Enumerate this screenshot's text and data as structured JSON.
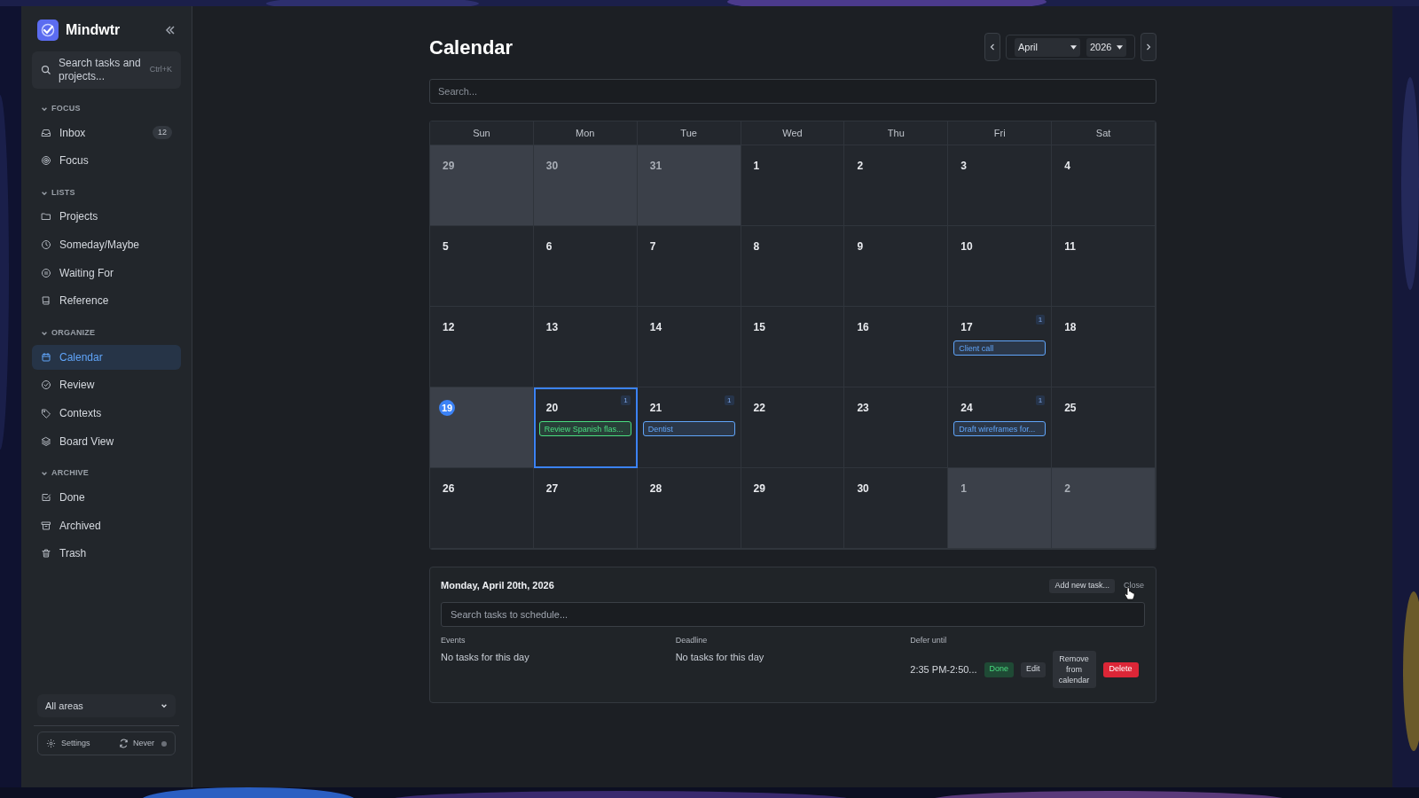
{
  "app": {
    "name": "Mindwtr"
  },
  "search": {
    "placeholder": "Search tasks and projects...",
    "shortcut": "Ctrl+K"
  },
  "sidebar": {
    "sections": [
      {
        "title": "FOCUS",
        "expanded": true,
        "items": [
          {
            "kind": "inbox",
            "label": "Inbox",
            "badge": "12",
            "selected": false
          },
          {
            "kind": "target",
            "label": "Focus",
            "selected": false
          }
        ]
      },
      {
        "title": "LISTS",
        "expanded": true,
        "items": [
          {
            "kind": "folder",
            "label": "Projects",
            "selected": false
          },
          {
            "kind": "clock",
            "label": "Someday/Maybe",
            "selected": false
          },
          {
            "kind": "pause",
            "label": "Waiting For",
            "selected": false
          },
          {
            "kind": "book",
            "label": "Reference",
            "selected": false
          }
        ]
      },
      {
        "title": "ORGANIZE",
        "expanded": true,
        "items": [
          {
            "kind": "calendar",
            "label": "Calendar",
            "selected": true
          },
          {
            "kind": "review",
            "label": "Review",
            "selected": false
          },
          {
            "kind": "tag",
            "label": "Contexts",
            "selected": false
          },
          {
            "kind": "layers",
            "label": "Board View",
            "selected": false
          }
        ]
      },
      {
        "title": "ARCHIVE",
        "expanded": true,
        "items": [
          {
            "kind": "done",
            "label": "Done",
            "selected": false
          },
          {
            "kind": "archive",
            "label": "Archived",
            "selected": false
          },
          {
            "kind": "trash",
            "label": "Trash",
            "selected": false
          }
        ]
      }
    ],
    "area": "All areas",
    "settings": "Settings",
    "sync": "Never"
  },
  "page": {
    "title": "Calendar",
    "month": "April",
    "year": "2026",
    "search_placeholder": "Search..."
  },
  "calendar": {
    "weekdays": [
      "Sun",
      "Mon",
      "Tue",
      "Wed",
      "Thu",
      "Fri",
      "Sat"
    ],
    "weeks": [
      [
        {
          "day": "29",
          "outside": true
        },
        {
          "day": "30",
          "outside": true
        },
        {
          "day": "31",
          "outside": true
        },
        {
          "day": "1",
          "outside": false
        },
        {
          "day": "2",
          "outside": false
        },
        {
          "day": "3",
          "outside": false
        },
        {
          "day": "4",
          "outside": false
        }
      ],
      [
        {
          "day": "5",
          "outside": false
        },
        {
          "day": "6",
          "outside": false
        },
        {
          "day": "7",
          "outside": false
        },
        {
          "day": "8",
          "outside": false
        },
        {
          "day": "9",
          "outside": false
        },
        {
          "day": "10",
          "outside": false
        },
        {
          "day": "11",
          "outside": false
        }
      ],
      [
        {
          "day": "12",
          "outside": false
        },
        {
          "day": "13",
          "outside": false
        },
        {
          "day": "14",
          "outside": false
        },
        {
          "day": "15",
          "outside": false
        },
        {
          "day": "16",
          "outside": false
        },
        {
          "day": "17",
          "outside": false,
          "count": "1",
          "events": [
            {
              "title": "Client call",
              "color": "#60a5fa"
            }
          ]
        },
        {
          "day": "18",
          "outside": false
        }
      ],
      [
        {
          "day": "19",
          "outside": false,
          "today": true
        },
        {
          "day": "20",
          "outside": false,
          "selected": true,
          "count": "1",
          "events": [
            {
              "title": "Review Spanish flas...",
              "color": "#4ade80"
            }
          ]
        },
        {
          "day": "21",
          "outside": false,
          "count": "1",
          "events": [
            {
              "title": "Dentist",
              "color": "#60a5fa"
            }
          ]
        },
        {
          "day": "22",
          "outside": false
        },
        {
          "day": "23",
          "outside": false
        },
        {
          "day": "24",
          "outside": false,
          "count": "1",
          "events": [
            {
              "title": "Draft wireframes for...",
              "color": "#60a5fa"
            }
          ]
        },
        {
          "day": "25",
          "outside": false
        }
      ],
      [
        {
          "day": "26",
          "outside": false
        },
        {
          "day": "27",
          "outside": false
        },
        {
          "day": "28",
          "outside": false
        },
        {
          "day": "29",
          "outside": false
        },
        {
          "day": "30",
          "outside": false
        },
        {
          "day": "1",
          "outside": true
        },
        {
          "day": "2",
          "outside": true
        }
      ]
    ]
  },
  "day_panel": {
    "title": "Monday, April 20th, 2026",
    "add_button": "Add new task...",
    "close": "Close",
    "search_placeholder": "Search tasks to schedule...",
    "columns": [
      {
        "heading": "Events",
        "empty": "No tasks for this day"
      },
      {
        "heading": "Deadline",
        "empty": "No tasks for this day"
      },
      {
        "heading": "Defer until",
        "items": [
          {
            "time": "2:35 PM-2:50...",
            "done": "Done",
            "edit": "Edit",
            "remove": "Remove from calendar",
            "delete": "Delete"
          }
        ]
      }
    ]
  }
}
